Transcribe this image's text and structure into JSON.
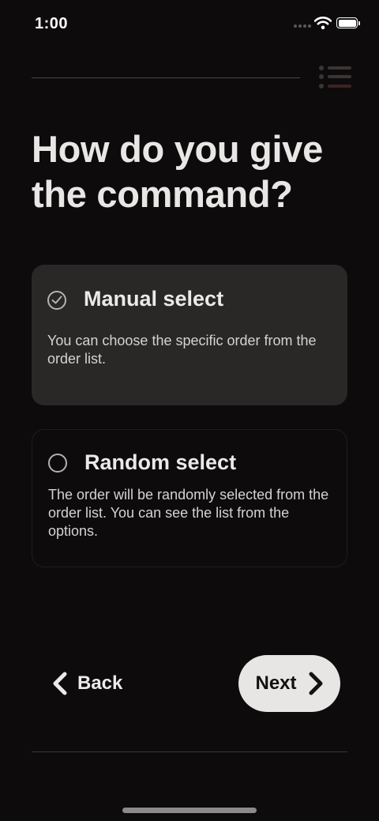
{
  "status_bar": {
    "time": "1:00"
  },
  "header": {
    "progress_fraction": 0.85
  },
  "page": {
    "title": "How do you give the command?"
  },
  "options": [
    {
      "title": "Manual select",
      "description": "You can choose the specific order from the order list.",
      "selected": true
    },
    {
      "title": "Random select",
      "description": "The order will be randomly selected from the order list. You can see the list from the options.",
      "selected": false
    }
  ],
  "navigation": {
    "back_label": "Back",
    "next_label": "Next"
  },
  "colors": {
    "background": "#0d0b0b",
    "card_selected": "#2a2727",
    "next_button": "#e8e5e5",
    "text": "#e9e6e6"
  },
  "icons": {
    "list": "list-icon",
    "check": "check-icon",
    "back": "chevron-left-icon",
    "next": "chevron-right-icon"
  }
}
